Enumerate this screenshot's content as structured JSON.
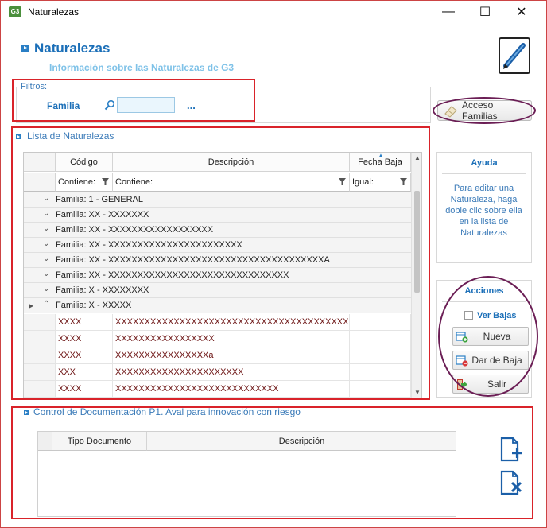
{
  "window": {
    "app_icon": "G3",
    "title": "Naturalezas",
    "minimize": "—",
    "maximize": "☐",
    "close": "✕"
  },
  "header": {
    "title": "Naturalezas",
    "subtitle": "Información sobre las Naturalezas de G3",
    "icon": "pencil-document-icon"
  },
  "filters": {
    "legend": "Filtros:",
    "familia_label": "Familia",
    "familia_value": "",
    "dots": "..."
  },
  "acceso_familias": {
    "label": "Acceso Familias",
    "icon": "eraser-icon"
  },
  "lista": {
    "title": "Lista de Naturalezas",
    "columns": {
      "codigo": "Código",
      "descripcion": "Descripción",
      "fecha_baja": "Fecha Baja"
    },
    "filters": {
      "codigo": "Contiene:",
      "descripcion": "Contiene:",
      "fecha_baja": "Igual:"
    },
    "groups": [
      {
        "text": "Familia: 1 - GENERAL",
        "chevron": "⌄"
      },
      {
        "text": "Familia: XX - XXXXXXX",
        "chevron": "⌄"
      },
      {
        "text": "Familia: XX - XXXXXXXXXXXXXXXXXX",
        "chevron": "⌄"
      },
      {
        "text": "Familia: XX - XXXXXXXXXXXXXXXXXXXXXXX",
        "chevron": "⌄"
      },
      {
        "text": "Familia: XX - XXXXXXXXXXXXXXXXXXXXXXXXXXXXXXXXXXXXXA",
        "chevron": "⌄"
      },
      {
        "text": "Familia: XX - XXXXXXXXXXXXXXXXXXXXXXXXXXXXXXX",
        "chevron": "⌄"
      },
      {
        "text": "Familia: X - XXXXXXXX",
        "chevron": "⌄"
      },
      {
        "text": "Familia: X - XXXXX",
        "chevron": "⌃"
      }
    ],
    "rows": [
      {
        "codigo": "XXXX",
        "descripcion": "XXXXXXXXXXXXXXXXXXXXXXXXXXXXXXXXXXXXXXXXXXXXXX)",
        "fecha_baja": ""
      },
      {
        "codigo": "XXXX",
        "descripcion": "XXXXXXXXXXXXXXXXX",
        "fecha_baja": ""
      },
      {
        "codigo": "XXXX",
        "descripcion": "XXXXXXXXXXXXXXXXa",
        "fecha_baja": ""
      },
      {
        "codigo": "XXX",
        "descripcion": "XXXXXXXXXXXXXXXXXXXXXX",
        "fecha_baja": ""
      },
      {
        "codigo": "XXXX",
        "descripcion": "XXXXXXXXXXXXXXXXXXXXXXXXXXXX",
        "fecha_baja": ""
      }
    ]
  },
  "ayuda": {
    "title": "Ayuda",
    "text": "Para editar una Naturaleza, haga doble clic sobre ella en la lista de Naturalezas"
  },
  "acciones": {
    "title": "Acciones",
    "ver_bajas": "Ver Bajas",
    "nueva": "Nueva",
    "dar_de_baja": "Dar de Baja",
    "salir": "Salir"
  },
  "control": {
    "title": "Control de Documentación P1. Aval para innovación con riesgo",
    "columns": {
      "tipo": "Tipo Documento",
      "descripcion": "Descripción"
    },
    "add_icon": "add-document-icon",
    "delete_icon": "delete-document-icon"
  },
  "colors": {
    "accent": "#1b6fb8",
    "highlight_box": "#d9232a",
    "ellipse": "#6b1e55"
  }
}
